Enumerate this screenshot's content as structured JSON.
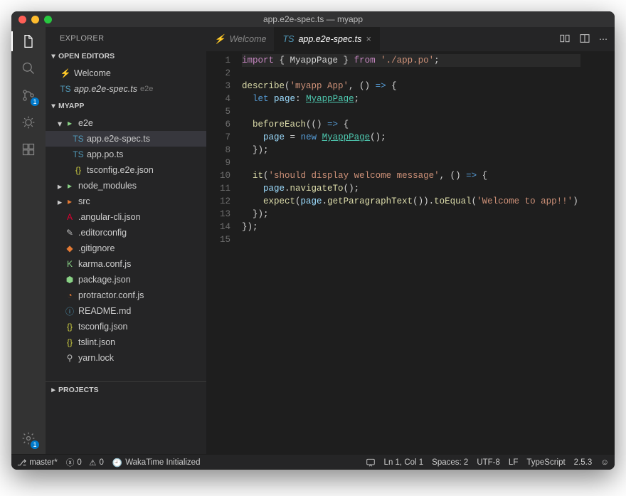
{
  "window_title": "app.e2e-spec.ts — myapp",
  "sidebar_title": "EXPLORER",
  "sections": {
    "open_editors": "OPEN EDITORS",
    "project": "MYAPP",
    "projects": "PROJECTS"
  },
  "open_editors": [
    {
      "label": "Welcome",
      "icon": "⚡",
      "iconcls": "or"
    },
    {
      "label": "app.e2e-spec.ts",
      "meta": "e2e",
      "icon": "TS",
      "iconcls": "bl",
      "italic": true
    }
  ],
  "tree": [
    {
      "d": 0,
      "label": "e2e",
      "folder": true,
      "open": true,
      "iconcls": "gn"
    },
    {
      "d": 1,
      "label": "app.e2e-spec.ts",
      "icon": "TS",
      "iconcls": "bl",
      "active": true
    },
    {
      "d": 1,
      "label": "app.po.ts",
      "icon": "TS",
      "iconcls": "bl"
    },
    {
      "d": 1,
      "label": "tsconfig.e2e.json",
      "icon": "{}",
      "iconcls": "ye"
    },
    {
      "d": 0,
      "label": "node_modules",
      "folder": true,
      "iconcls": "gn"
    },
    {
      "d": 0,
      "label": "src",
      "folder": true,
      "iconcls": "rd"
    },
    {
      "d": 0,
      "label": ".angular-cli.json",
      "icon": "A",
      "iconcls": "ng"
    },
    {
      "d": 0,
      "label": ".editorconfig",
      "icon": "✎",
      "iconcls": "lk"
    },
    {
      "d": 0,
      "label": ".gitignore",
      "icon": "◆",
      "iconcls": "rd"
    },
    {
      "d": 0,
      "label": "karma.conf.js",
      "icon": "K",
      "iconcls": "gn"
    },
    {
      "d": 0,
      "label": "package.json",
      "icon": "⬢",
      "iconcls": "gn"
    },
    {
      "d": 0,
      "label": "protractor.conf.js",
      "icon": "◔",
      "iconcls": "rd"
    },
    {
      "d": 0,
      "label": "README.md",
      "icon": "ⓘ",
      "iconcls": "mk"
    },
    {
      "d": 0,
      "label": "tsconfig.json",
      "icon": "{}",
      "iconcls": "ye"
    },
    {
      "d": 0,
      "label": "tslint.json",
      "icon": "{}",
      "iconcls": "ye"
    },
    {
      "d": 0,
      "label": "yarn.lock",
      "icon": "⚲",
      "iconcls": "lk"
    }
  ],
  "tabs": [
    {
      "label": "Welcome",
      "icon": "⚡",
      "iconcls": "or"
    },
    {
      "label": "app.e2e-spec.ts",
      "icon": "TS",
      "iconcls": "bl",
      "active": true,
      "close": "×"
    }
  ],
  "code_lines": [
    "<span class='k'>import</span> <span class='d'>{ MyappPage }</span> <span class='k'>from</span> <span class='s'>'./app.po'</span><span class='d'>;</span>",
    "",
    "<span class='f'>describe</span><span class='d'>(</span><span class='s'>'myapp App'</span><span class='d'>, () </span><span class='b'>=&gt;</span><span class='d'> {</span>",
    "  <span class='b'>let</span> <span class='p'>page</span><span class='d'>:</span> <span class='t'>MyappPage</span><span class='d'>;</span>",
    "",
    "  <span class='f'>beforeEach</span><span class='d'>(() </span><span class='b'>=&gt;</span><span class='d'> {</span>",
    "    <span class='p'>page</span> <span class='d'>=</span> <span class='b'>new</span> <span class='t'>MyappPage</span><span class='d'>();</span>",
    "  <span class='d'>});</span>",
    "",
    "  <span class='f'>it</span><span class='d'>(</span><span class='s'>'should display welcome message'</span><span class='d'>, () </span><span class='b'>=&gt;</span><span class='d'> {</span>",
    "    <span class='p'>page</span><span class='d'>.</span><span class='f'>navigateTo</span><span class='d'>();</span>",
    "    <span class='f'>expect</span><span class='d'>(</span><span class='p'>page</span><span class='d'>.</span><span class='f'>getParagraphText</span><span class='d'>()).</span><span class='f'>toEqual</span><span class='d'>(</span><span class='s'>'Welcome to app!!'</span><span class='d'>)</span>",
    "  <span class='d'>});</span>",
    "<span class='d'>});</span>",
    ""
  ],
  "status": {
    "branch": "master*",
    "errors": "0",
    "warnings": "0",
    "waka": "WakaTime Initialized",
    "ln": "Ln 1, Col 1",
    "spaces": "Spaces: 2",
    "enc": "UTF-8",
    "eol": "LF",
    "lang": "TypeScript",
    "ver": "2.5.3"
  },
  "badges": {
    "scm": "1",
    "gear": "1"
  }
}
